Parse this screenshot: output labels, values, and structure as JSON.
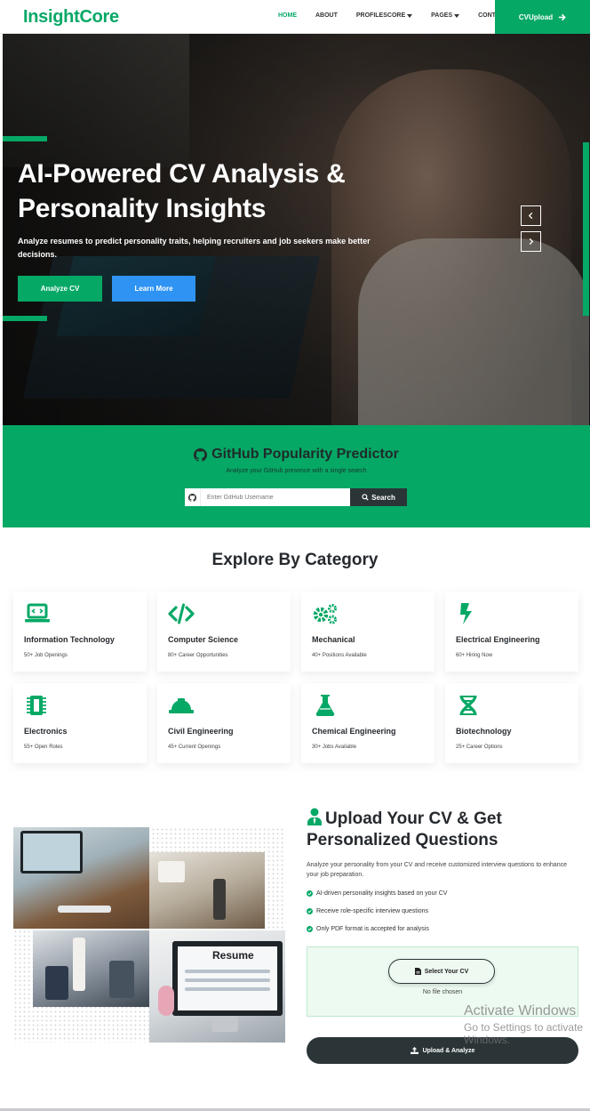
{
  "nav": {
    "brand": "InsightCore",
    "items": [
      {
        "label": "HOME",
        "active": true,
        "dropdown": false
      },
      {
        "label": "ABOUT",
        "active": false,
        "dropdown": false
      },
      {
        "label": "PROFILESCORE",
        "active": false,
        "dropdown": true
      },
      {
        "label": "PAGES",
        "active": false,
        "dropdown": true
      },
      {
        "label": "CONTACT",
        "active": false,
        "dropdown": false
      }
    ],
    "cta_label": "CVUpload",
    "cta_icon": "arrow-right-icon"
  },
  "hero": {
    "title": "AI-Powered CV Analysis & Personality Insights",
    "lead": "Analyze resumes to predict personality traits, helping recruiters and job seekers make better decisions.",
    "primary_button": "Analyze CV",
    "secondary_button": "Learn More",
    "prev_icon": "chevron-left-icon",
    "next_icon": "chevron-right-icon"
  },
  "github": {
    "title": "GitHub Popularity Predictor",
    "subtitle": "Analyze your GitHub presence with a single search",
    "input_placeholder": "Enter GitHub Username",
    "input_value": "",
    "button_label": "Search"
  },
  "categories": {
    "title": "Explore By Category",
    "items": [
      {
        "name": "Information Technology",
        "stat": "50+ Job Openings",
        "icon": "laptop-code-icon"
      },
      {
        "name": "Computer Science",
        "stat": "80+ Career Opportunities",
        "icon": "code-icon"
      },
      {
        "name": "Mechanical",
        "stat": "40+ Positions Available",
        "icon": "gears-icon"
      },
      {
        "name": "Electrical Engineering",
        "stat": "60+ Hiring Now",
        "icon": "bolt-icon"
      },
      {
        "name": "Electronics",
        "stat": "55+ Open Roles",
        "icon": "microchip-icon"
      },
      {
        "name": "Civil Engineering",
        "stat": "45+ Current Openings",
        "icon": "hard-hat-icon"
      },
      {
        "name": "Chemical Engineering",
        "stat": "30+ Jobs Available",
        "icon": "flask-icon"
      },
      {
        "name": "Biotechnology",
        "stat": "25+ Career Options",
        "icon": "dna-icon"
      }
    ]
  },
  "upload": {
    "title": "Upload Your CV & Get Personalized Questions",
    "description": "Analyze your personality from your CV and receive customized interview questions to enhance your job preparation.",
    "checks": [
      "AI-driven personality insights based on your CV",
      "Receive role-specific interview questions",
      "Only PDF format is accepted for analysis"
    ],
    "select_label": "Select Your CV",
    "file_status": "No file chosen",
    "submit_label": "Upload & Analyze",
    "photo_resume_text": "Resume"
  },
  "watermark": {
    "line1": "Activate Windows",
    "line2": "Go to Settings to activate Windows."
  },
  "colors": {
    "brand_green": "#06a866",
    "blue": "#2f93f3",
    "dark": "#2b3537"
  }
}
